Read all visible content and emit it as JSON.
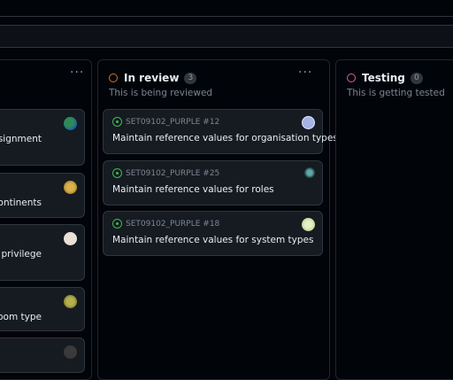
{
  "columns": {
    "left": {
      "cards": [
        {
          "title": "ssignment",
          "avatar": "green-blob"
        },
        {
          "title": "ontinents",
          "avatar": "yellow-face"
        },
        {
          "title": "ystem privilege",
          "avatar": "avatar-text"
        },
        {
          "title": "oom type",
          "avatar": "olive-face"
        },
        {
          "title": "",
          "avatar": "dark-face"
        }
      ]
    },
    "in_review": {
      "title": "In review",
      "count": "3",
      "description": "This is being reviewed",
      "more": "···",
      "cards": [
        {
          "ref": "SET09102_PURPLE #12",
          "title": "Maintain reference values for organisation types",
          "avatar": "lavender"
        },
        {
          "ref": "SET09102_PURPLE #25",
          "title": "Maintain reference values for roles",
          "avatar": "dark-teal"
        },
        {
          "ref": "SET09102_PURPLE #18",
          "title": "Maintain reference values for system types",
          "avatar": "pale-green"
        }
      ]
    },
    "testing": {
      "title": "Testing",
      "count": "0",
      "description": "This is getting tested"
    },
    "left_more": "···"
  },
  "colors": {
    "in_review_ring": "#db6d28",
    "testing_ring": "#db61a2",
    "open_issue": "#3fb950"
  }
}
